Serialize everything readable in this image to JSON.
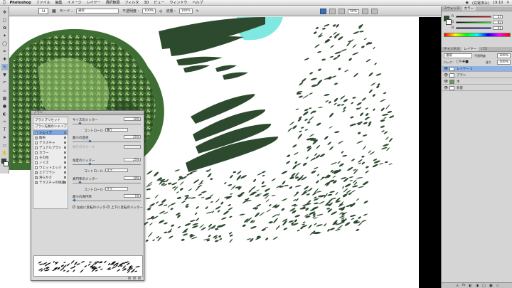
{
  "menubar": {
    "app": "Photoshop",
    "items": [
      "ファイル",
      "編集",
      "イメージ",
      "レイヤー",
      "選択範囲",
      "フィルタ",
      "3D",
      "ビュー",
      "ウィンドウ",
      "ヘルプ"
    ],
    "status": [
      "(充電済み)",
      "19:10"
    ]
  },
  "options": {
    "brush_size": "14",
    "mode_label": "モード :",
    "mode_value": "通常",
    "opacity_label": "不透明度 :",
    "opacity_value": "100%",
    "flow_label": "流量 :",
    "flow_value": "100%",
    "zoom": "50%"
  },
  "color_panel": {
    "tabs": [
      "スウォッチ",
      "カラー"
    ],
    "r": "57",
    "g": "82",
    "b": "61"
  },
  "layers_panel": {
    "tabs": [
      "チャンネル",
      "レイヤー",
      "パス"
    ],
    "blend": "通常",
    "opacity_label": "不透明度",
    "opacity": "100%",
    "lock_label": "ロック :",
    "fill_label": "塗り",
    "fill": "100%",
    "layers": [
      "レイヤー 1",
      "ブラシ",
      "木",
      "背景"
    ]
  },
  "brush_dialog": {
    "title": "ブラシ",
    "preset_header": "ブラシプリセット",
    "tip_header": "ブラシ先端のシェイプ",
    "options": [
      {
        "label": "シェイプ",
        "checked": true,
        "selected": true
      },
      {
        "label": "散布",
        "checked": true,
        "selected": false
      },
      {
        "label": "テクスチャ",
        "checked": false,
        "selected": false
      },
      {
        "label": "デュアルブラシ",
        "checked": false,
        "selected": false
      },
      {
        "label": "カラー",
        "checked": false,
        "selected": false
      },
      {
        "label": "その他",
        "checked": false,
        "selected": false
      },
      {
        "label": "ノイズ",
        "checked": false,
        "selected": false
      },
      {
        "label": "ウェットエッジ",
        "checked": false,
        "selected": false
      },
      {
        "label": "エアブラシ",
        "checked": true,
        "selected": false
      },
      {
        "label": "滑らかさ",
        "checked": true,
        "selected": false
      },
      {
        "label": "テクスチャの保護",
        "checked": true,
        "selected": false
      }
    ],
    "size_jitter_label": "サイズのジッター",
    "size_jitter": "10%",
    "control_label": "コントロール :",
    "control_value_1": "筆圧",
    "min_diameter_label": "最小の直径",
    "min_diameter": "25%",
    "tilt_scale_label": "傾きのスケール",
    "angle_jitter_label": "角度のジッター",
    "angle_jitter": "25%",
    "control_value_2": "オフ",
    "roundness_jitter_label": "真円率のジッター",
    "roundness_jitter": "10%",
    "control_value_3": "オフ",
    "min_roundness_label": "最小の真円率",
    "min_roundness": "1%",
    "flip_x_label": "左右に反転のジッター",
    "flip_y_label": "上下に反転のジッター"
  },
  "colors": {
    "brush_green": "#2d4a2e",
    "tree_dark": "#2f5a2a",
    "tree_light": "#8dbf6a",
    "cyan_spot": "#7fe8e0",
    "selection": "#7ea5de"
  }
}
